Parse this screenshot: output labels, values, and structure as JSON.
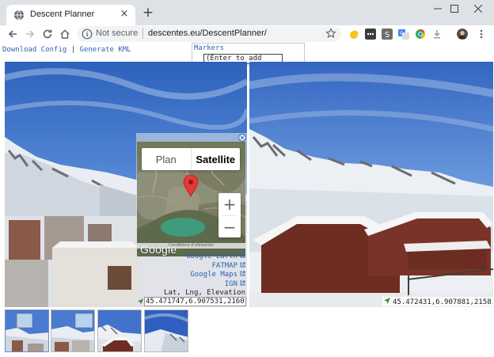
{
  "browser": {
    "tab_title": "Descent Planner",
    "tab_close": "×",
    "new_tab": "+",
    "security_label": "Not secure",
    "url": "descentes.eu/DescentPlanner/"
  },
  "page": {
    "links": [
      {
        "label": "Download Config"
      },
      {
        "label": "Generate KML"
      }
    ],
    "link_separator": "|",
    "markers": {
      "title": "Markers",
      "placeholder": "(Enter to add new)"
    }
  },
  "overlay": {
    "map_tabs": {
      "plan": "Plan",
      "satellite": "Satellite"
    },
    "zoom_in": "+",
    "zoom_out": "−",
    "google_logo": "Google",
    "map_footer": "Conditions d'utilisation",
    "ext_links": [
      {
        "label": "Google Earth"
      },
      {
        "label": "FATMAP"
      },
      {
        "label": "Google Maps"
      },
      {
        "label": "IGN"
      }
    ],
    "latlng_label": "Lat, Lng, Elevation",
    "coordinates": "45.471747,6.907531,2160.5"
  },
  "right_photo": {
    "coordinates": "45.472431,6.907881,2158.8"
  },
  "thumbnails": [
    {
      "name": "thumb-1",
      "selected": true
    },
    {
      "name": "thumb-2"
    },
    {
      "name": "thumb-3"
    },
    {
      "name": "thumb-4"
    }
  ],
  "colors": {
    "link": "#2a63b5",
    "chrome_bg": "#dee1e6",
    "sky": "#3a6cc4",
    "snow": "#f2f4f8"
  }
}
